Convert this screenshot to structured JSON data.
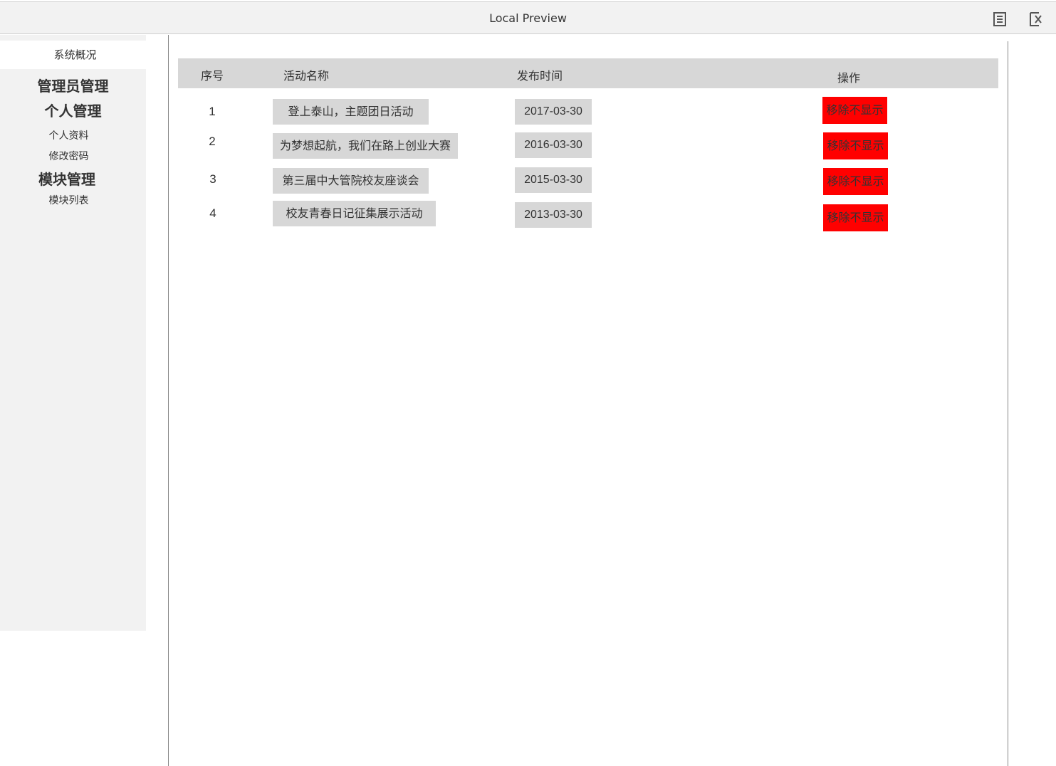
{
  "window": {
    "title": "Local Preview",
    "icons": [
      "document-icon",
      "close-window-icon"
    ]
  },
  "sidebar": {
    "overview": "系统概况",
    "groups": [
      {
        "label": "管理员管理",
        "items": []
      },
      {
        "label": "个人管理",
        "items": [
          "个人资料",
          "修改密码"
        ]
      },
      {
        "label": "模块管理",
        "items": [
          "模块列表"
        ]
      }
    ]
  },
  "table": {
    "headers": [
      "序号",
      "活动名称",
      "发布时间",
      "操作"
    ],
    "rows": [
      {
        "index": "1",
        "name": "登上泰山，主题团日活动",
        "date": "2017-03-30",
        "action": "移除不显示"
      },
      {
        "index": "2",
        "name": "为梦想起航，我们在路上创业大赛",
        "date": "2016-03-30",
        "action": "移除不显示"
      },
      {
        "index": "3",
        "name": "第三届中大管院校友座谈会",
        "date": "2015-03-30",
        "action": "移除不显示"
      },
      {
        "index": "4",
        "name": "校友青春日记征集展示活动",
        "date": "2013-03-30",
        "action": "移除不显示"
      }
    ]
  },
  "colors": {
    "header_bg": "#d7d7d7",
    "sidebar_bg": "#f2f2f2",
    "remove_button": "#ff0000"
  }
}
